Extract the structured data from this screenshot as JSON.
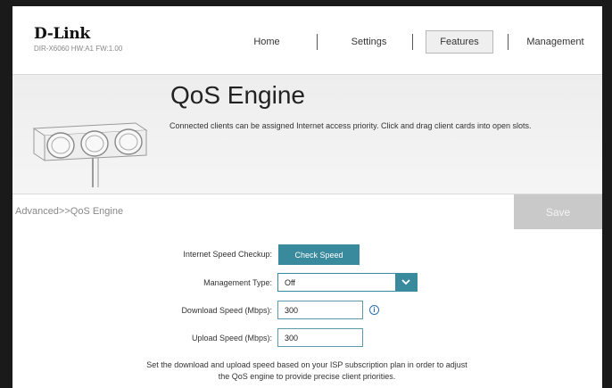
{
  "header": {
    "brand": "D-Link",
    "model": "DIR-X6060 HW:A1 FW:1.00",
    "nav": {
      "home": "Home",
      "settings": "Settings",
      "features": "Features",
      "management": "Management"
    }
  },
  "banner": {
    "title": "QoS Engine",
    "description": "Connected clients can be assigned Internet access priority. Click and drag client cards into open slots."
  },
  "breadcrumb": "Advanced>>QoS Engine",
  "save_label": "Save",
  "form": {
    "speed_checkup_label": "Internet Speed Checkup:",
    "check_speed_label": "Check Speed",
    "management_type_label": "Management Type:",
    "management_type_value": "Off",
    "download_label": "Download Speed (Mbps):",
    "download_value": "300",
    "upload_label": "Upload Speed (Mbps):",
    "upload_value": "300"
  },
  "note": {
    "line1": "Set the download and upload speed based on your ISP subscription plan in order to adjust",
    "line2": "the QoS engine to provide precise client priorities."
  },
  "colors": {
    "accent": "#3a8a9d",
    "info": "#2a6fb0",
    "save_disabled": "#c9c9c9"
  },
  "icons": {
    "info": "info-icon",
    "dropdown": "chevron-down-icon",
    "illustration": "traffic-light-icon"
  }
}
